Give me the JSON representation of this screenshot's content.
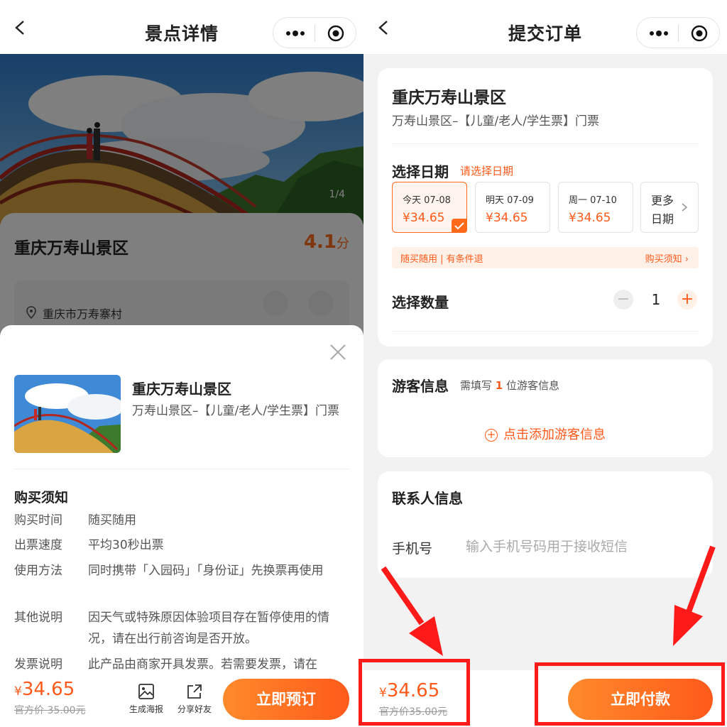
{
  "left": {
    "nav": {
      "title": "景点详情"
    },
    "hero": {
      "counter": "1/4"
    },
    "info": {
      "name": "重庆万寿山景区",
      "score": "4.1",
      "score_unit": "分",
      "address": "重庆市万寿寨村"
    },
    "sheet": {
      "title": "重庆万寿山景区",
      "subtitle": "万寿山景区–【儿童/老人/学生票】门票",
      "notice_title": "购买须知",
      "notices": [
        {
          "k": "购买时间",
          "v": "随买随用"
        },
        {
          "k": "出票速度",
          "v": "平均30秒出票"
        },
        {
          "k": "使用方法",
          "v": "同时携带「入园码」「身份证」先换票再使用"
        },
        {
          "k": "其他说明",
          "v": "因天气或特殊原因体验项目存在暂停使用的情况，请在出行前咨询是否开放。"
        },
        {
          "k": "发票说明",
          "v": "此产品由商家开具发票。若需要发票，请在"
        }
      ]
    },
    "bottom": {
      "currency": "¥",
      "price": "34.65",
      "original": "官方价 35.00元",
      "poster_label": "生成海报",
      "share_label": "分享好友",
      "book_label": "立即预订"
    }
  },
  "right": {
    "nav": {
      "title": "提交订单"
    },
    "product": {
      "name": "重庆万寿山景区",
      "ticket": "万寿山景区–【儿童/老人/学生票】门票"
    },
    "date": {
      "label": "选择日期",
      "hint": "请选择日期",
      "options": [
        {
          "day": "今天 07-08",
          "price": "¥34.65",
          "selected": true
        },
        {
          "day": "明天 07-09",
          "price": "¥34.65",
          "selected": false
        },
        {
          "day": "周一 07-10",
          "price": "¥34.65",
          "selected": false
        }
      ],
      "more_line1": "更多",
      "more_line2": "日期"
    },
    "refund": {
      "left": "随买随用 | 有条件退",
      "right": "购买须知 ›"
    },
    "quantity": {
      "label": "选择数量",
      "minus": "−",
      "value": "1",
      "plus": "+"
    },
    "guest": {
      "title": "游客信息",
      "hint_prefix": "需填写",
      "hint_count": "1",
      "hint_suffix": "位游客信息",
      "add_label": "点击添加游客信息"
    },
    "contact": {
      "title": "联系人信息",
      "phone_label": "手机号",
      "phone_placeholder": "输入手机号码用于接收短信"
    },
    "bottom": {
      "currency": "¥",
      "price": "34.65",
      "original": "官方价35.00元",
      "pay_label": "立即付款"
    }
  },
  "colors": {
    "accent": "#ff5a1a",
    "annotation": "#ff1a1a"
  }
}
